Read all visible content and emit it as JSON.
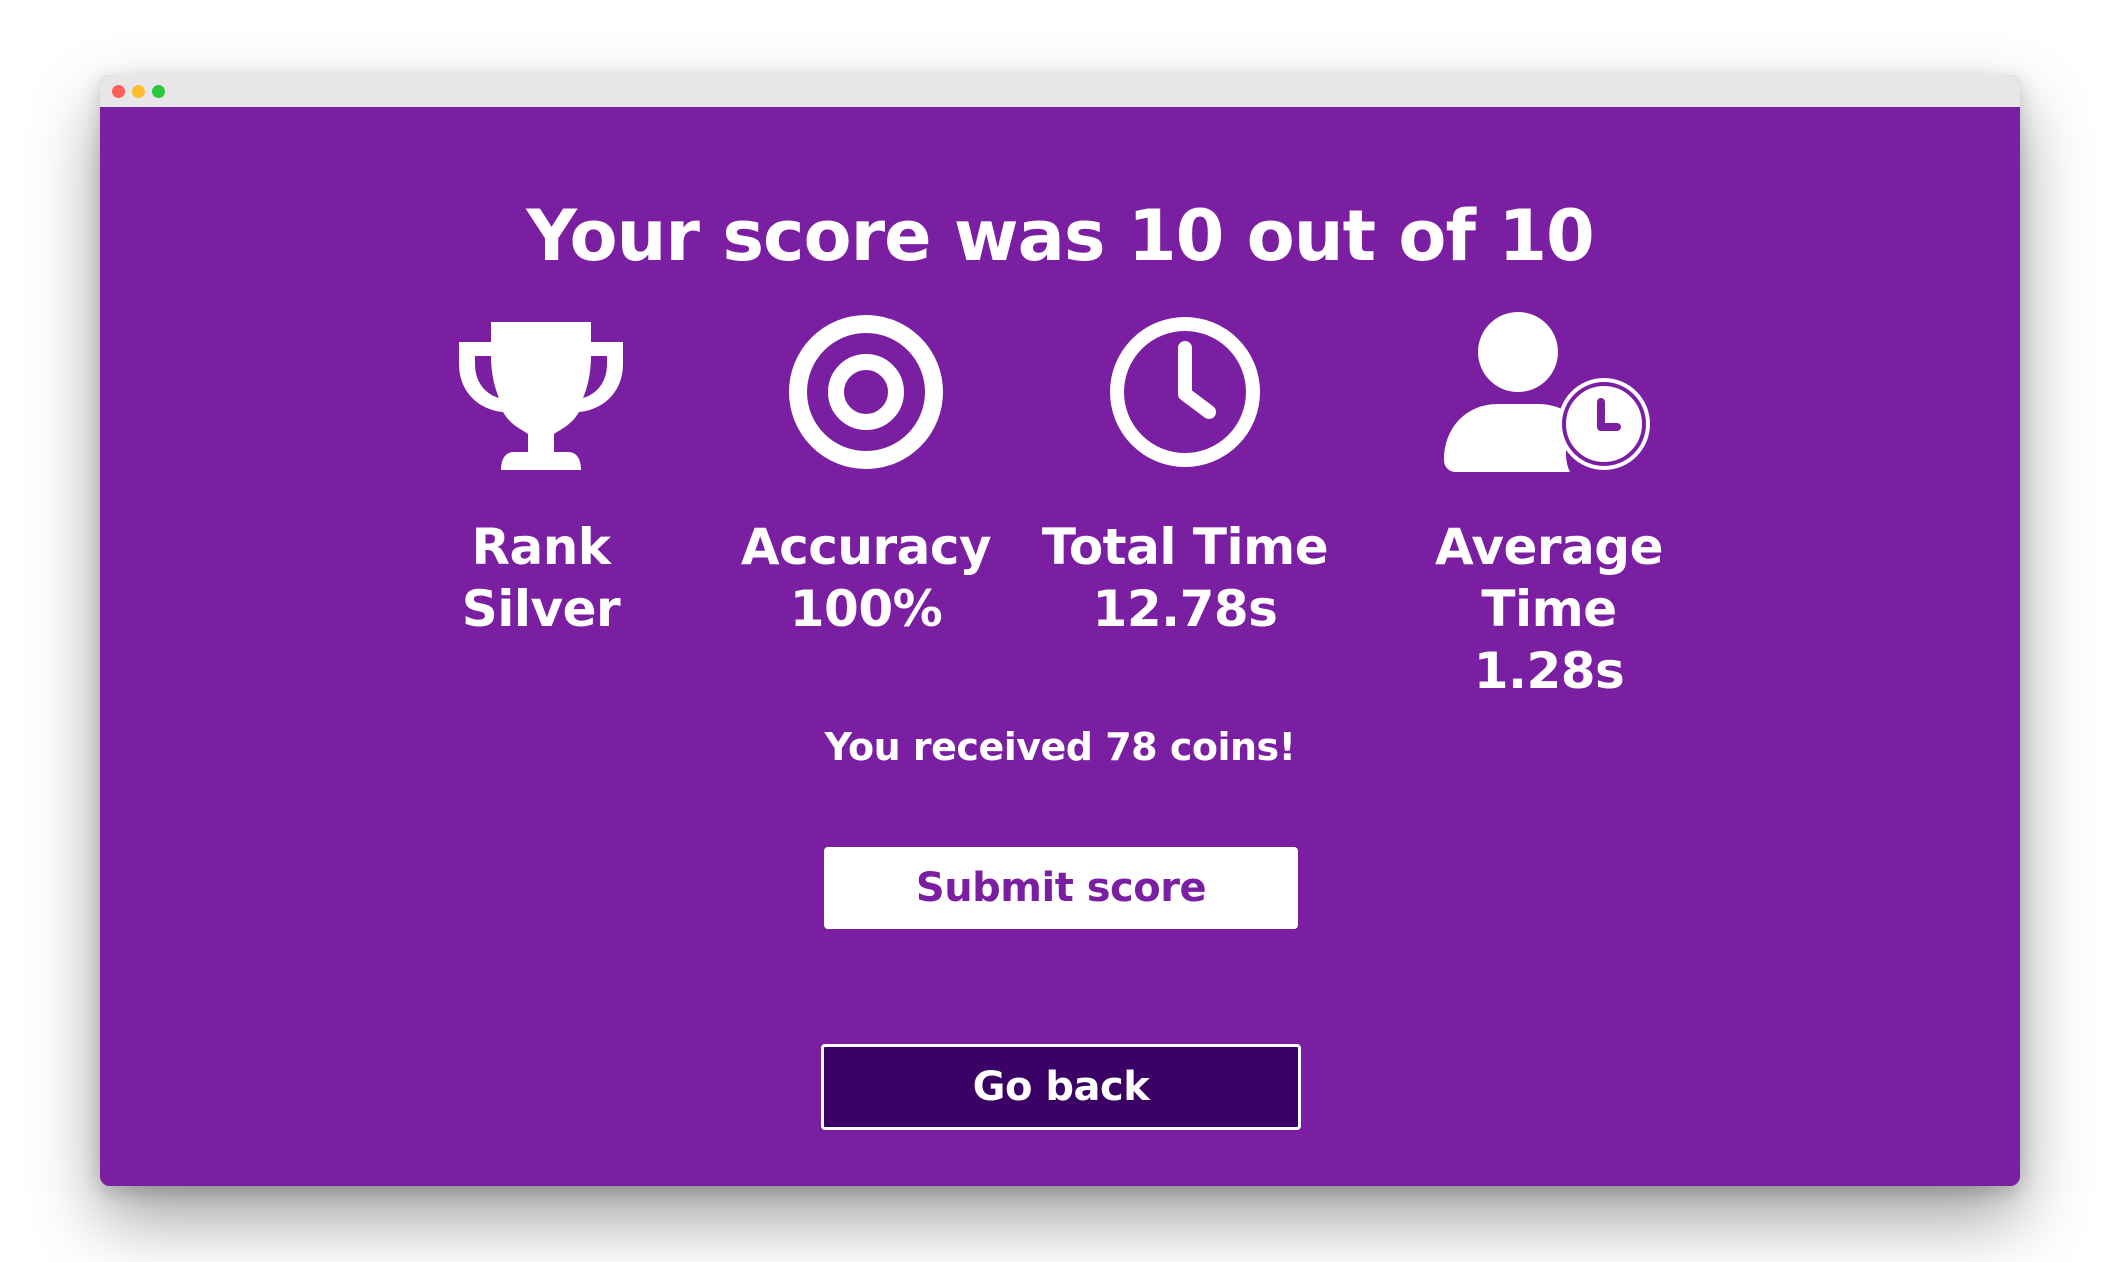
{
  "results": {
    "title": "Your score was 10 out of 10",
    "stats": [
      {
        "icon": "trophy-icon",
        "label": "Rank",
        "value": "Silver"
      },
      {
        "icon": "target-icon",
        "label": "Accuracy",
        "value": "100%"
      },
      {
        "icon": "clock-icon",
        "label": "Total Time",
        "value": "12.78s"
      },
      {
        "icon": "user-clock-icon",
        "label": "Average Time",
        "value": "1.28s"
      }
    ],
    "coins_message": "You received 78 coins!",
    "submit_label": "Submit score",
    "back_label": "Go back"
  },
  "colors": {
    "background": "#7b1fa2",
    "text": "#ffffff",
    "back_button": "#3a0066"
  }
}
